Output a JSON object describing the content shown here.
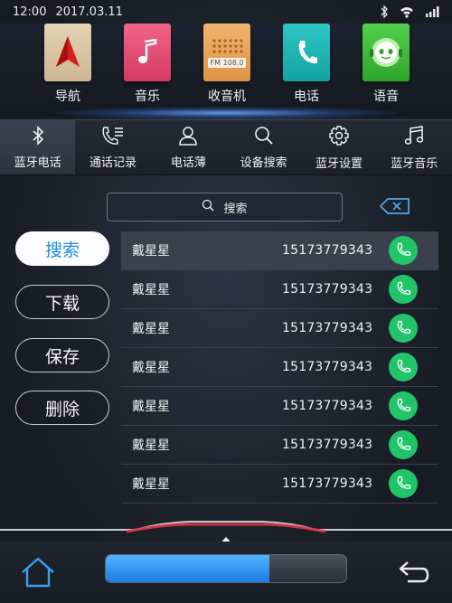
{
  "status_bar": {
    "time": "12:00",
    "date": "2017.03.11"
  },
  "apps": [
    {
      "label": "导航",
      "icon": "navigation-arrow-icon",
      "color": "#d8c3a2"
    },
    {
      "label": "音乐",
      "icon": "music-note-icon",
      "color": "#e84a72"
    },
    {
      "label": "收音机",
      "icon": "radio-icon",
      "color": "#e8a35a",
      "radio_text": "FM 108.0"
    },
    {
      "label": "电话",
      "icon": "phone-icon",
      "color": "#1fb7b6"
    },
    {
      "label": "语音",
      "icon": "voice-robot-icon",
      "color": "#3fbf3b"
    }
  ],
  "tabs": [
    {
      "label": "蓝牙电话",
      "icon": "bluetooth-icon",
      "active": true
    },
    {
      "label": "通话记录",
      "icon": "call-log-icon",
      "active": false
    },
    {
      "label": "电话薄",
      "icon": "contacts-icon",
      "active": false
    },
    {
      "label": "设备搜索",
      "icon": "search-icon",
      "active": false
    },
    {
      "label": "蓝牙设置",
      "icon": "gear-icon",
      "active": false
    },
    {
      "label": "蓝牙音乐",
      "icon": "music-icon",
      "active": false
    }
  ],
  "search": {
    "label": "搜索"
  },
  "side_buttons": [
    {
      "label": "搜索",
      "active": true
    },
    {
      "label": "下载",
      "active": false
    },
    {
      "label": "保存",
      "active": false
    },
    {
      "label": "删除",
      "active": false
    }
  ],
  "contacts": [
    {
      "name": "戴星星",
      "number": "15173779343"
    },
    {
      "name": "戴星星",
      "number": "15173779343"
    },
    {
      "name": "戴星星",
      "number": "15173779343"
    },
    {
      "name": "戴星星",
      "number": "15173779343"
    },
    {
      "name": "戴星星",
      "number": "15173779343"
    },
    {
      "name": "戴星星",
      "number": "15173779343"
    },
    {
      "name": "戴星星",
      "number": "15173779343"
    }
  ],
  "volume": {
    "level": 0.68
  },
  "colors": {
    "accent": "#1f8fe0",
    "call_green": "#22c46a",
    "backspace": "#4aa8e8"
  }
}
